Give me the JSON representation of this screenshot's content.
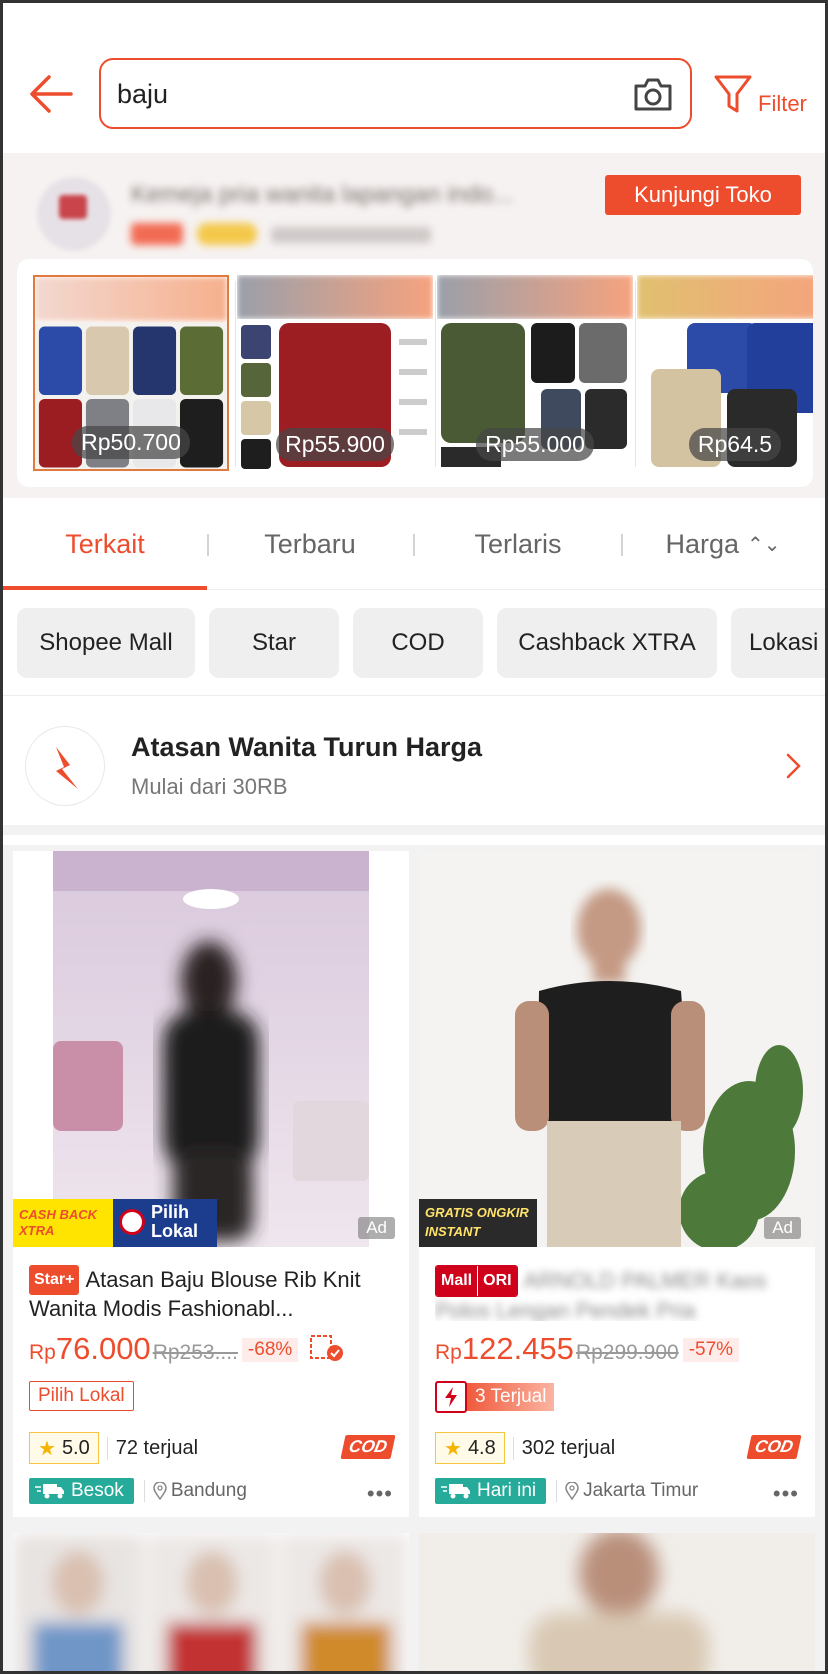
{
  "search": {
    "query": "baju"
  },
  "header": {
    "filter_label": "Filter"
  },
  "shop_banner": {
    "visit_label": "Kunjungi Toko",
    "products": [
      {
        "price": "Rp50.700"
      },
      {
        "price": "Rp55.900"
      },
      {
        "price": "Rp55.000"
      },
      {
        "price": "Rp64.5"
      }
    ]
  },
  "sort_tabs": [
    {
      "label": "Terkait"
    },
    {
      "label": "Terbaru"
    },
    {
      "label": "Terlaris"
    },
    {
      "label": "Harga"
    }
  ],
  "filter_chips": [
    {
      "label": "Shopee Mall"
    },
    {
      "label": "Star"
    },
    {
      "label": "COD"
    },
    {
      "label": "Cashback XTRA"
    },
    {
      "label": "Lokasi"
    }
  ],
  "promo": {
    "title": "Atasan Wanita Turun Harga",
    "subtitle": "Mulai dari 30RB"
  },
  "products": [
    {
      "badge": "Star+",
      "title": "Atasan Baju Blouse Rib Knit Wanita Modis Fashionabl...",
      "currency": "Rp",
      "price": "76.000",
      "old_price": "Rp253....",
      "discount": "-68%",
      "tag": "Pilih Lokal",
      "rating": "5.0",
      "sold": "72 terjual",
      "cod": "COD",
      "delivery": "Besok",
      "location": "Bandung",
      "ad": "Ad",
      "image_label_1": "CASH BACK XTRA",
      "image_label_2": "Pilih Lokal"
    },
    {
      "badge_mall": "Mall",
      "badge_ori": "ORI",
      "currency": "Rp",
      "price": "122.455",
      "old_price": "Rp299.900",
      "discount": "-57%",
      "flash_sold": "3 Terjual",
      "rating": "4.8",
      "sold": "302 terjual",
      "cod": "COD",
      "delivery": "Hari ini",
      "location": "Jakarta Timur",
      "ad": "Ad",
      "image_label_1": "GRATIS ONGKIR INSTANT"
    }
  ],
  "colors": {
    "brand": "#ee4d2d",
    "delivery": "#26aa99"
  }
}
